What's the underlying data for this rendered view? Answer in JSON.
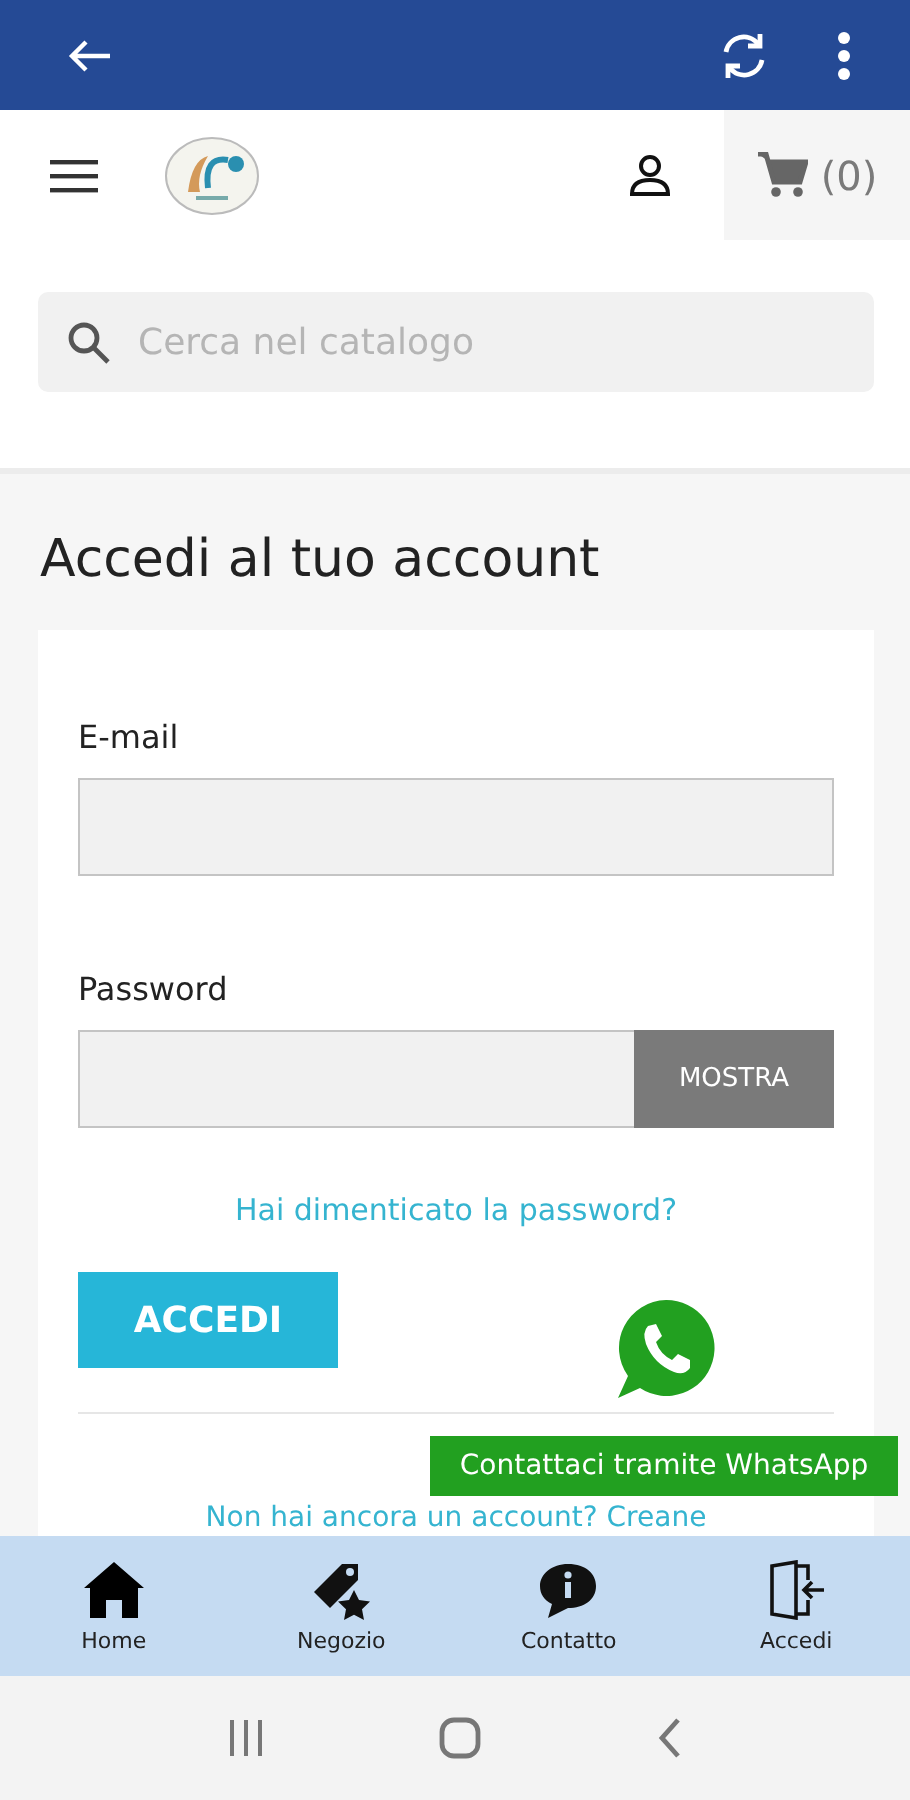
{
  "header": {
    "cart_count": "(0)"
  },
  "search": {
    "placeholder": "Cerca nel catalogo"
  },
  "title": "Accedi al tuo account",
  "form": {
    "email_label": "E-mail",
    "password_label": "Password",
    "show_button": "MOSTRA",
    "forgot_link": "Hai dimenticato la password?",
    "submit": "ACCEDI",
    "register_link": "Non hai ancora un account? Creane"
  },
  "whatsapp": {
    "label": "Contattaci tramite WhatsApp"
  },
  "bottom_nav": [
    {
      "label": "Home"
    },
    {
      "label": "Negozio"
    },
    {
      "label": "Contatto"
    },
    {
      "label": "Accedi"
    }
  ]
}
